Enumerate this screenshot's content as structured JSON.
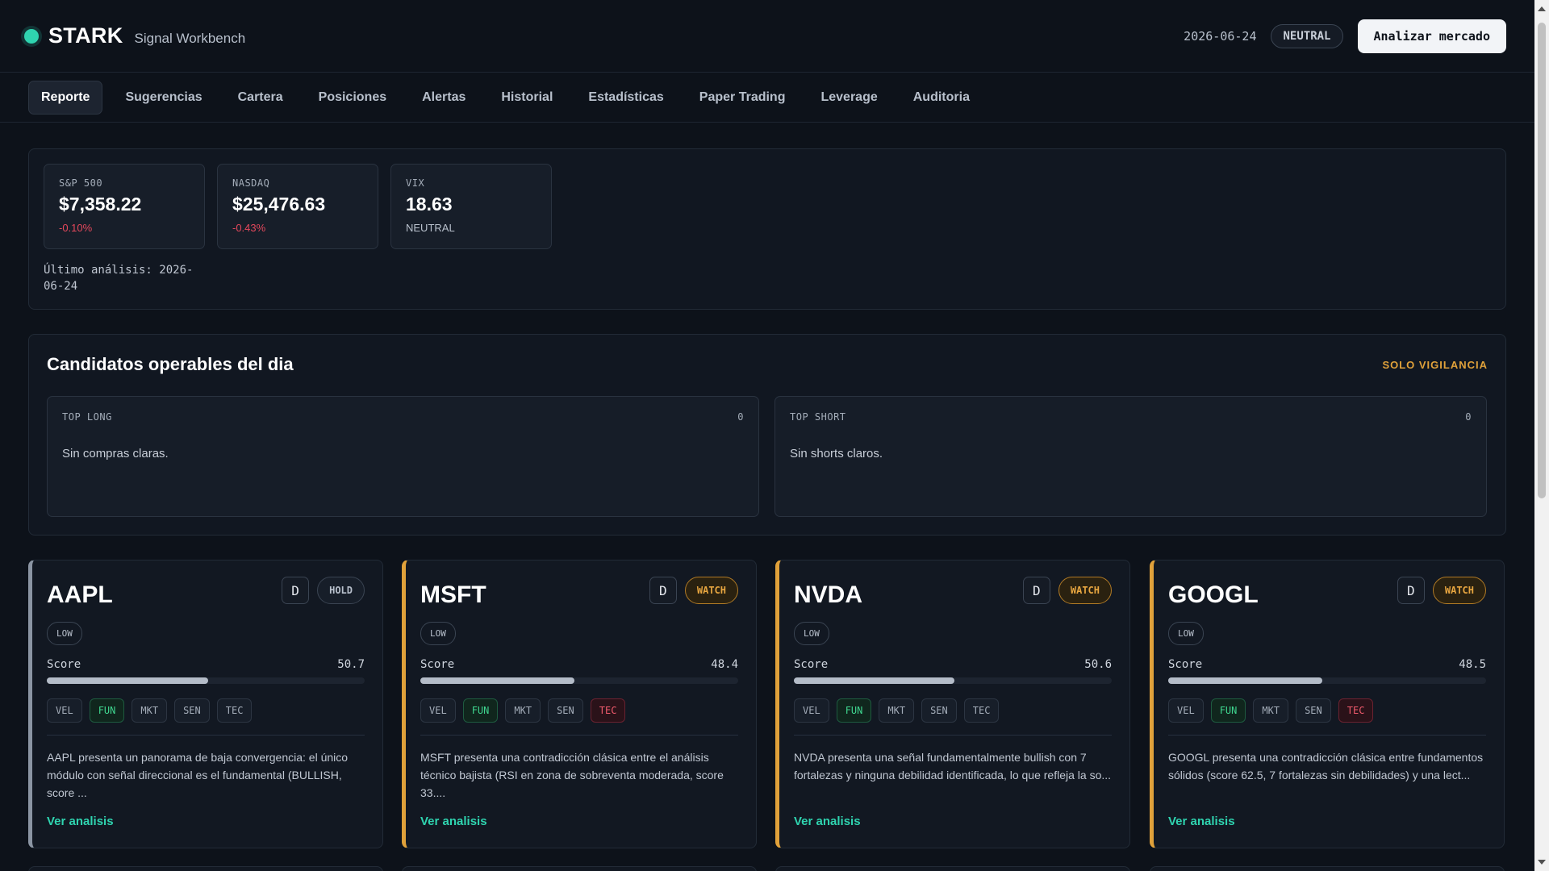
{
  "header": {
    "brand": "STARK",
    "subtitle": "Signal Workbench",
    "date": "2026-06-24",
    "sentiment": "NEUTRAL",
    "analyze_button": "Analizar mercado",
    "accent_color": "#2fd4b0"
  },
  "tabs": [
    {
      "label": "Reporte",
      "active": true
    },
    {
      "label": "Sugerencias"
    },
    {
      "label": "Cartera"
    },
    {
      "label": "Posiciones"
    },
    {
      "label": "Alertas"
    },
    {
      "label": "Historial"
    },
    {
      "label": "Estadísticas"
    },
    {
      "label": "Paper Trading"
    },
    {
      "label": "Leverage"
    },
    {
      "label": "Auditoria"
    }
  ],
  "market": {
    "indices": [
      {
        "label": "S&P 500",
        "value": "$7,358.22",
        "change": "-0.10%"
      },
      {
        "label": "NASDAQ",
        "value": "$25,476.63",
        "change": "-0.43%"
      },
      {
        "label": "VIX",
        "value": "18.63",
        "change": "NEUTRAL"
      }
    ],
    "last_analysis": "Último análisis: 2026-06-24"
  },
  "candidates": {
    "title": "Candidatos operables del dia",
    "flag": "SOLO VIGILANCIA",
    "long": {
      "label": "TOP LONG",
      "count": "0",
      "text": "Sin compras claras."
    },
    "short": {
      "label": "TOP SHORT",
      "count": "0",
      "text": "Sin shorts claros."
    }
  },
  "stocks": [
    {
      "ticker": "AAPL",
      "timeframe": "D",
      "status": "HOLD",
      "risk": "LOW",
      "score_label": "Score",
      "score": "50.7",
      "score_value": 50.7,
      "chips": [
        {
          "label": "VEL",
          "tone": "neutral"
        },
        {
          "label": "FUN",
          "tone": "pos"
        },
        {
          "label": "MKT",
          "tone": "neutral"
        },
        {
          "label": "SEN",
          "tone": "neutral"
        },
        {
          "label": "TEC",
          "tone": "neutral"
        }
      ],
      "summary": "AAPL presenta un panorama de baja convergencia: el único módulo con señal direccional es el fundamental (BULLISH, score ...",
      "link": "Ver analisis"
    },
    {
      "ticker": "MSFT",
      "timeframe": "D",
      "status": "WATCH",
      "risk": "LOW",
      "score_label": "Score",
      "score": "48.4",
      "score_value": 48.4,
      "chips": [
        {
          "label": "VEL",
          "tone": "neutral"
        },
        {
          "label": "FUN",
          "tone": "pos"
        },
        {
          "label": "MKT",
          "tone": "neutral"
        },
        {
          "label": "SEN",
          "tone": "neutral"
        },
        {
          "label": "TEC",
          "tone": "neg"
        }
      ],
      "summary": "MSFT presenta una contradicción clásica entre el análisis técnico bajista (RSI en zona de sobreventa moderada, score 33....",
      "link": "Ver analisis"
    },
    {
      "ticker": "NVDA",
      "timeframe": "D",
      "status": "WATCH",
      "risk": "LOW",
      "score_label": "Score",
      "score": "50.6",
      "score_value": 50.6,
      "chips": [
        {
          "label": "VEL",
          "tone": "neutral"
        },
        {
          "label": "FUN",
          "tone": "pos"
        },
        {
          "label": "MKT",
          "tone": "neutral"
        },
        {
          "label": "SEN",
          "tone": "neutral"
        },
        {
          "label": "TEC",
          "tone": "neutral"
        }
      ],
      "summary": "NVDA presenta una señal fundamentalmente bullish con 7 fortalezas y ninguna debilidad identificada, lo que refleja la so...",
      "link": "Ver analisis"
    },
    {
      "ticker": "GOOGL",
      "timeframe": "D",
      "status": "WATCH",
      "risk": "LOW",
      "score_label": "Score",
      "score": "48.5",
      "score_value": 48.5,
      "chips": [
        {
          "label": "VEL",
          "tone": "neutral"
        },
        {
          "label": "FUN",
          "tone": "pos"
        },
        {
          "label": "MKT",
          "tone": "neutral"
        },
        {
          "label": "SEN",
          "tone": "neutral"
        },
        {
          "label": "TEC",
          "tone": "neg"
        }
      ],
      "summary": "GOOGL presenta una contradicción clásica entre fundamentos sólidos (score 62.5, 7 fortalezas sin debilidades) y una lect...",
      "link": "Ver analisis"
    }
  ]
}
